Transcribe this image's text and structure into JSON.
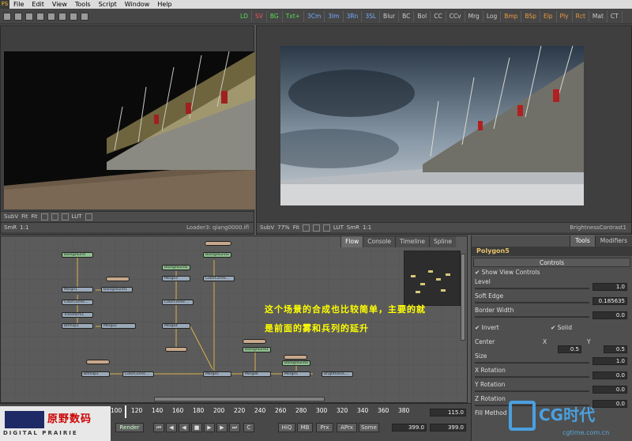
{
  "menubar": {
    "logo": "FS",
    "items": [
      "File",
      "Edit",
      "View",
      "Tools",
      "Script",
      "Window",
      "Help"
    ]
  },
  "toolbar": {
    "buttons": [
      {
        "label": "LD",
        "color": "green"
      },
      {
        "label": "SV",
        "color": "red"
      },
      {
        "label": "BG",
        "color": "green"
      },
      {
        "label": "Txt+",
        "color": "green"
      },
      {
        "label": "3Cm",
        "color": "blue"
      },
      {
        "label": "3Im",
        "color": "blue"
      },
      {
        "label": "3Rn",
        "color": "blue"
      },
      {
        "label": "3SL",
        "color": "blue"
      },
      {
        "label": "Blur",
        "color": "grey"
      },
      {
        "label": "BC",
        "color": "grey"
      },
      {
        "label": "Bol",
        "color": "grey"
      },
      {
        "label": "CC",
        "color": "grey"
      },
      {
        "label": "CCv",
        "color": "grey"
      },
      {
        "label": "Mrg",
        "color": "grey"
      },
      {
        "label": "Log",
        "color": "grey"
      },
      {
        "label": "Bmp",
        "color": "orange"
      },
      {
        "label": "BSp",
        "color": "orange"
      },
      {
        "label": "Elp",
        "color": "orange"
      },
      {
        "label": "Ply",
        "color": "orange"
      },
      {
        "label": "Rct",
        "color": "orange"
      },
      {
        "label": "Mat",
        "color": "grey"
      },
      {
        "label": "CT",
        "color": "grey"
      }
    ]
  },
  "viewer_left": {
    "subv": "SubV",
    "fit1": "Fit",
    "fit2": "Fit",
    "lut": "LUT",
    "smr": "SmR",
    "ratio": "1:1",
    "label": "Loader3: qiang0000.ifl"
  },
  "viewer_right": {
    "subv": "SubV",
    "zoom": "77%",
    "fit": "Fit",
    "lut": "LUT",
    "smr": "SmR",
    "ratio": "1:1",
    "label": "BrightnessContrast1"
  },
  "flow": {
    "tabs": [
      "Flow",
      "Console",
      "Timeline",
      "Spline"
    ],
    "overlay_line1": "这个场景的合成也比较简单，主要的就",
    "overlay_line2": "是前面的雾和兵列的延升",
    "nodes": [
      "Merge1",
      "Merge2",
      "Merge3",
      "Merge4",
      "Merge5",
      "Merge6",
      "ColorCorrec...",
      "Transform1",
      "Bitmap1",
      "Background1",
      "Background2",
      "Background3",
      "BrightnessC..."
    ]
  },
  "tools": {
    "tabs": [
      "Tools",
      "Modifiers"
    ],
    "tool_name": "Polygon5",
    "section": "Controls",
    "show_view_controls": "Show View Controls",
    "params": [
      {
        "label": "Level",
        "value": "1.0"
      },
      {
        "label": "Soft Edge",
        "value": "0.185635"
      },
      {
        "label": "Border Width",
        "value": "0.0"
      }
    ],
    "invert": "Invert",
    "solid": "Solid",
    "center_label": "Center",
    "x_label": "X",
    "x_value": "0.5",
    "y_label": "Y",
    "y_value": "0.5",
    "size_label": "Size",
    "size_value": "1.0",
    "xrot_label": "X Rotation",
    "xrot_value": "0.0",
    "yrot_label": "Y Rotation",
    "yrot_value": "0.0",
    "zrot_label": "Z Rotation",
    "zrot_value": "0.0",
    "fill_method": "Fill Method"
  },
  "timeline": {
    "ticks": [
      "100",
      "120",
      "140",
      "160",
      "180",
      "200",
      "220",
      "240",
      "260",
      "280",
      "300",
      "320",
      "340",
      "360",
      "380"
    ],
    "current": "115.0",
    "render": "Render",
    "hiq": "HiQ",
    "mb": "MB",
    "prx": "Prx",
    "aprx": "APrx",
    "some": "Some",
    "end1": "399.0",
    "end2": "399.0"
  },
  "brand": {
    "cn": "原野数码",
    "en": "DIGITAL PRAIRIE"
  },
  "watermark": {
    "cg": "CG时代",
    "url": "cgtime.com.cn"
  }
}
